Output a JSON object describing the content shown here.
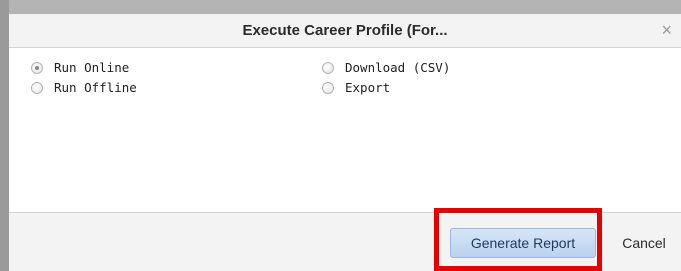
{
  "dialog": {
    "title": "Execute Career Profile (For...",
    "close_glyph": "×"
  },
  "options": [
    {
      "label": "Run Online",
      "checked": true
    },
    {
      "label": "Run Offline",
      "checked": false
    },
    {
      "label": "Download (CSV)",
      "checked": false
    },
    {
      "label": "Export",
      "checked": false
    }
  ],
  "footer": {
    "generate_label": "Generate Report",
    "cancel_label": "Cancel"
  },
  "colors": {
    "highlight": "#e60000",
    "primary_button": "#c7dcf3"
  }
}
